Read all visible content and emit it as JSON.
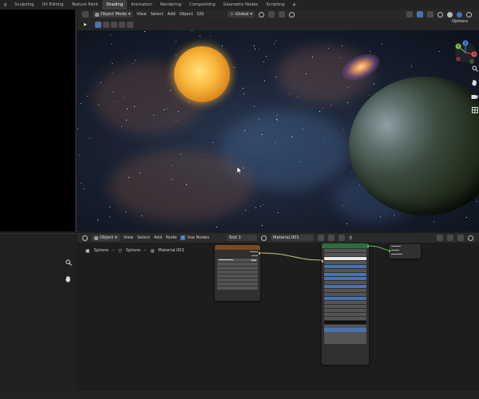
{
  "workspace_tabs": [
    {
      "label": "g",
      "active": false
    },
    {
      "label": "Sculpting",
      "active": false
    },
    {
      "label": "UV Editing",
      "active": false
    },
    {
      "label": "Texture Paint",
      "active": false
    },
    {
      "label": "Shading",
      "active": true
    },
    {
      "label": "Animation",
      "active": false
    },
    {
      "label": "Rendering",
      "active": false
    },
    {
      "label": "Compositing",
      "active": false
    },
    {
      "label": "Geometry Nodes",
      "active": false
    },
    {
      "label": "Scripting",
      "active": false
    }
  ],
  "add_workspace": "+",
  "viewport": {
    "mode": "Object Mode",
    "menus": [
      "View",
      "Select",
      "Add",
      "Object",
      "GIS"
    ],
    "orientation": "Global",
    "options_label": "Options",
    "gizmo_axes": [
      "X",
      "Y",
      "Z"
    ],
    "nav_icons": [
      "zoom-icon",
      "hand-icon",
      "camera-icon",
      "grid-icon"
    ]
  },
  "node_editor": {
    "mode": "Object",
    "menus": [
      "View",
      "Select",
      "Add",
      "Node"
    ],
    "use_nodes_label": "Use Nodes",
    "use_nodes_checked": true,
    "slot": "Slot 1",
    "material": "Material.001",
    "breadcrumb": [
      "Sphere",
      "Sphere",
      "Material.001"
    ]
  },
  "colors": {
    "accent_blue": "#4772b3",
    "node_texture_header": "#7a4a20",
    "node_shader_header": "#2c6e3a",
    "link_yellow": "#c8c873",
    "link_green": "#63c763"
  }
}
